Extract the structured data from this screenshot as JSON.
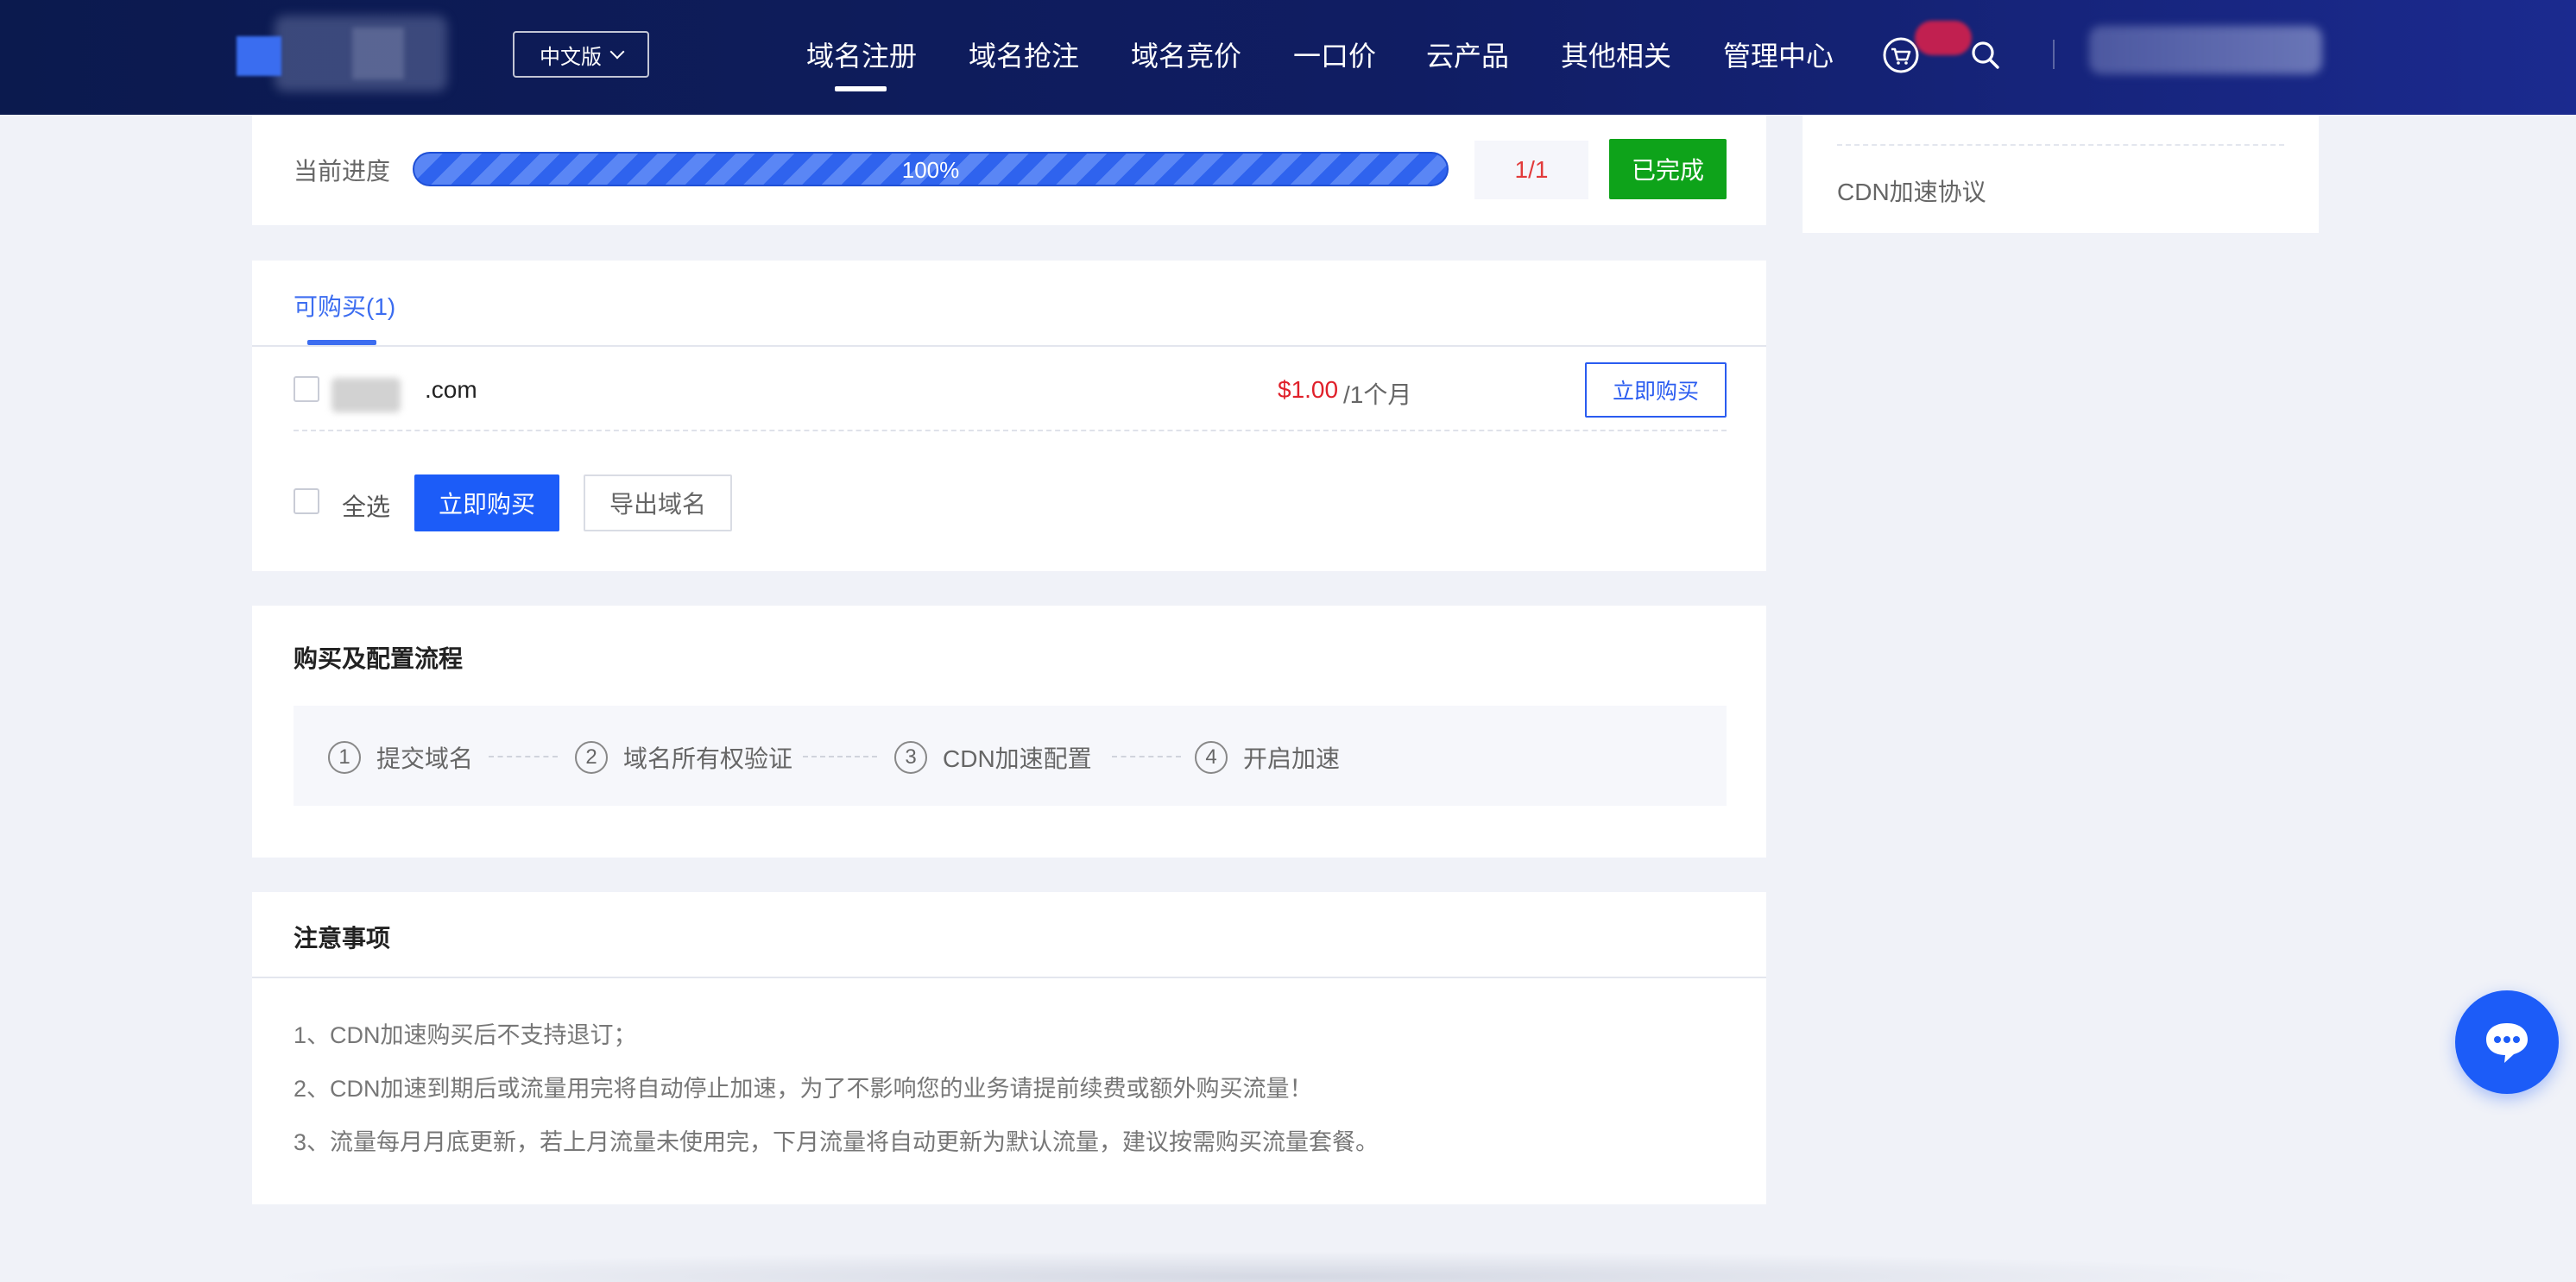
{
  "header": {
    "lang_label": "中文版",
    "nav": [
      {
        "label": "域名注册",
        "active": true
      },
      {
        "label": "域名抢注"
      },
      {
        "label": "域名竞价"
      },
      {
        "label": "一口价"
      },
      {
        "label": "云产品"
      },
      {
        "label": "其他相关"
      },
      {
        "label": "管理中心"
      }
    ],
    "cart_icon": "cart-icon",
    "search_icon": "search-icon"
  },
  "progress": {
    "label": "当前进度",
    "percent_text": "100%",
    "fraction": 1.0,
    "count": "1/1",
    "status_button": "已完成"
  },
  "purchase": {
    "tab_label": "可购买(1)",
    "rows": [
      {
        "domain_suffix": ".com",
        "price": "$1.00",
        "period": "/1个月",
        "buy_label": "立即购买"
      }
    ],
    "select_all": "全选",
    "buy_now": "立即购买",
    "export": "导出域名"
  },
  "flow": {
    "title": "购买及配置流程",
    "steps": [
      {
        "num": "1",
        "label": "提交域名"
      },
      {
        "num": "2",
        "label": "域名所有权验证"
      },
      {
        "num": "3",
        "label": "CDN加速配置"
      },
      {
        "num": "4",
        "label": "开启加速"
      }
    ]
  },
  "notice": {
    "title": "注意事项",
    "items": [
      "1、CDN加速购买后不支持退订；",
      "2、CDN加速到期后或流量用完将自动停止加速，为了不影响您的业务请提前续费或额外购买流量！",
      "3、流量每月月底更新，若上月流量未使用完，下月流量将自动更新为默认流量，建议按需购买流量套餐。"
    ]
  },
  "sidebar": {
    "link": "CDN加速协议"
  },
  "chat": {
    "icon": "chat-bubble-icon"
  },
  "colors": {
    "header_bg": "#101d63",
    "primary": "#1c5cf8",
    "success": "#0ea31a",
    "price": "#e0202a"
  }
}
